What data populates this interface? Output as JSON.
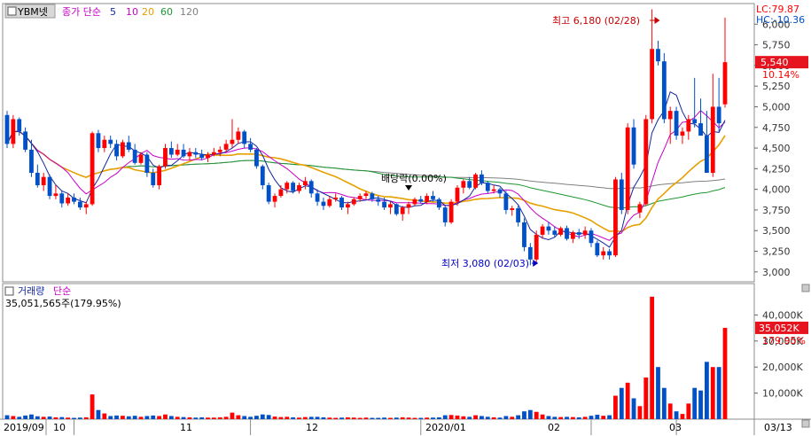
{
  "header": {
    "symbol": "YBM넷",
    "ma_label_prefix": "종가 단순",
    "ma_periods": [
      "5",
      "10",
      "20",
      "60",
      "120"
    ]
  },
  "right_badges": {
    "lc": "LC:79.87",
    "hc": "HC:-10.36"
  },
  "colors": {
    "up": "#ff0000",
    "down": "#0050c8",
    "ma5": "#1428a0",
    "ma10": "#c800c8",
    "ma20": "#e6a000",
    "ma60": "#1e9632",
    "ma120": "#808080",
    "current_price_bg": "#e6141e"
  },
  "annotations": {
    "high": "최고 6,180 (02/28)",
    "low": "최저 3,080 (02/03)",
    "dividend": "배당락(0.00%)"
  },
  "current": {
    "price": "5,540",
    "change": "10.14%",
    "volume": "35,052K",
    "volume_change": "179.95%"
  },
  "volume_panel": {
    "title": "거래량",
    "subtitle": "단순",
    "value_text": "35,051,565주(179.95%)"
  },
  "x_axis_labels": [
    "2019/09",
    "10",
    "11",
    "12",
    "2020/01",
    "02",
    "03",
    "03/13"
  ],
  "chart_data": {
    "type": "candlestick",
    "price_axis": {
      "ylim": [
        2880,
        6250
      ],
      "ticks": [
        3000,
        3250,
        3500,
        3750,
        4000,
        4250,
        4500,
        4750,
        5000,
        5250,
        5500,
        5750,
        6000
      ],
      "tick_labels": [
        "3,000",
        "3,250",
        "3,500",
        "3,750",
        "4,000",
        "4,250",
        "4,500",
        "4,750",
        "5,000",
        "5,250",
        "5,500",
        "5,750",
        "6,000"
      ]
    },
    "volume_axis": {
      "ylim": [
        0,
        50000
      ],
      "ticks": [
        10000,
        20000,
        30000,
        40000
      ],
      "tick_labels": [
        "10,000K",
        "20,000K",
        "30,000K",
        "40,000K"
      ]
    },
    "candles": [
      [
        4900,
        4950,
        4500,
        4550,
        1500
      ],
      [
        4550,
        4900,
        4500,
        4850,
        1200
      ],
      [
        4850,
        4870,
        4650,
        4700,
        900
      ],
      [
        4700,
        4750,
        4450,
        4480,
        1400
      ],
      [
        4480,
        4600,
        4150,
        4200,
        1800
      ],
      [
        4200,
        4300,
        4020,
        4050,
        1100
      ],
      [
        4050,
        4200,
        3980,
        4150,
        900
      ],
      [
        4150,
        4180,
        3880,
        3920,
        1000
      ],
      [
        3920,
        4050,
        3880,
        3950,
        700
      ],
      [
        3950,
        3980,
        3780,
        3830,
        800
      ],
      [
        3830,
        3950,
        3800,
        3900,
        600
      ],
      [
        3900,
        3950,
        3820,
        3850,
        500
      ],
      [
        3850,
        3900,
        3750,
        3780,
        600
      ],
      [
        3780,
        3850,
        3700,
        3820,
        700
      ],
      [
        3820,
        4700,
        3800,
        4680,
        9500
      ],
      [
        4680,
        4720,
        4450,
        4500,
        3500
      ],
      [
        4500,
        4650,
        4450,
        4600,
        2200
      ],
      [
        4600,
        4650,
        4500,
        4550,
        1200
      ],
      [
        4550,
        4600,
        4350,
        4400,
        1400
      ],
      [
        4400,
        4600,
        4380,
        4570,
        1300
      ],
      [
        4570,
        4650,
        4450,
        4480,
        1100
      ],
      [
        4480,
        4550,
        4300,
        4320,
        1300
      ],
      [
        4320,
        4450,
        4300,
        4420,
        900
      ],
      [
        4420,
        4450,
        4150,
        4200,
        1200
      ],
      [
        4200,
        4250,
        4020,
        4050,
        1400
      ],
      [
        4050,
        4300,
        4000,
        4280,
        1200
      ],
      [
        4280,
        4550,
        4250,
        4500,
        1800
      ],
      [
        4500,
        4580,
        4380,
        4420,
        1200
      ],
      [
        4420,
        4550,
        4400,
        4480,
        900
      ],
      [
        4480,
        4550,
        4380,
        4400,
        800
      ],
      [
        4400,
        4500,
        4350,
        4450,
        700
      ],
      [
        4450,
        4500,
        4380,
        4420,
        600
      ],
      [
        4420,
        4480,
        4350,
        4380,
        700
      ],
      [
        4380,
        4450,
        4330,
        4420,
        600
      ],
      [
        4420,
        4500,
        4400,
        4450,
        600
      ],
      [
        4450,
        4520,
        4400,
        4480,
        700
      ],
      [
        4480,
        4600,
        4450,
        4550,
        900
      ],
      [
        4550,
        4850,
        4500,
        4600,
        2500
      ],
      [
        4600,
        4750,
        4550,
        4700,
        1500
      ],
      [
        4700,
        4720,
        4500,
        4550,
        1200
      ],
      [
        4550,
        4620,
        4450,
        4480,
        900
      ],
      [
        4480,
        4500,
        4250,
        4280,
        1300
      ],
      [
        4280,
        4300,
        4000,
        4050,
        1800
      ],
      [
        4050,
        4080,
        3820,
        3850,
        1600
      ],
      [
        3850,
        3950,
        3780,
        3920,
        1000
      ],
      [
        3920,
        4050,
        3900,
        4000,
        800
      ],
      [
        4000,
        4100,
        3950,
        4080,
        900
      ],
      [
        4080,
        4100,
        3950,
        3980,
        700
      ],
      [
        3980,
        4080,
        3950,
        4050,
        600
      ],
      [
        4050,
        4150,
        4000,
        4100,
        800
      ],
      [
        4100,
        4120,
        3900,
        3950,
        900
      ],
      [
        3950,
        4000,
        3800,
        3850,
        900
      ],
      [
        3850,
        3900,
        3750,
        3800,
        700
      ],
      [
        3800,
        3920,
        3780,
        3880,
        600
      ],
      [
        3880,
        3950,
        3850,
        3900,
        500
      ],
      [
        3900,
        3920,
        3750,
        3780,
        600
      ],
      [
        3780,
        3850,
        3700,
        3820,
        700
      ],
      [
        3820,
        3900,
        3800,
        3880,
        600
      ],
      [
        3880,
        3950,
        3850,
        3920,
        500
      ],
      [
        3920,
        3980,
        3880,
        3950,
        600
      ],
      [
        3950,
        3970,
        3850,
        3880,
        500
      ],
      [
        3880,
        3920,
        3800,
        3850,
        500
      ],
      [
        3850,
        3900,
        3750,
        3780,
        600
      ],
      [
        3780,
        3850,
        3700,
        3820,
        500
      ],
      [
        3820,
        3830,
        3680,
        3700,
        600
      ],
      [
        3700,
        3800,
        3620,
        3780,
        700
      ],
      [
        3780,
        3850,
        3700,
        3820,
        600
      ],
      [
        3820,
        3900,
        3800,
        3880,
        500
      ],
      [
        3880,
        3920,
        3830,
        3850,
        500
      ],
      [
        3850,
        3950,
        3820,
        3920,
        600
      ],
      [
        3920,
        3980,
        3850,
        3880,
        600
      ],
      [
        3880,
        3900,
        3750,
        3780,
        700
      ],
      [
        3780,
        3800,
        3550,
        3600,
        1500
      ],
      [
        3600,
        3880,
        3580,
        3850,
        1600
      ],
      [
        3850,
        4050,
        3800,
        4020,
        1400
      ],
      [
        4020,
        4120,
        3950,
        4100,
        1100
      ],
      [
        4100,
        4150,
        4000,
        4020,
        900
      ],
      [
        4020,
        4200,
        4000,
        4180,
        1500
      ],
      [
        4180,
        4230,
        4050,
        4080,
        1200
      ],
      [
        4080,
        4100,
        3950,
        3980,
        900
      ],
      [
        3980,
        4050,
        3950,
        4000,
        700
      ],
      [
        4000,
        4020,
        3900,
        3950,
        600
      ],
      [
        3950,
        3980,
        3700,
        3750,
        1200
      ],
      [
        3750,
        3800,
        3680,
        3770,
        900
      ],
      [
        3770,
        3800,
        3550,
        3600,
        1500
      ],
      [
        3600,
        3650,
        3250,
        3300,
        3000
      ],
      [
        3300,
        3350,
        3080,
        3150,
        3500
      ],
      [
        3150,
        3500,
        3100,
        3450,
        2800
      ],
      [
        3450,
        3580,
        3400,
        3550,
        1800
      ],
      [
        3550,
        3600,
        3450,
        3500,
        1200
      ],
      [
        3500,
        3550,
        3420,
        3450,
        900
      ],
      [
        3450,
        3550,
        3430,
        3530,
        800
      ],
      [
        3530,
        3560,
        3380,
        3400,
        900
      ],
      [
        3400,
        3500,
        3350,
        3480,
        800
      ],
      [
        3480,
        3520,
        3400,
        3450,
        700
      ],
      [
        3450,
        3550,
        3400,
        3500,
        900
      ],
      [
        3500,
        3530,
        3300,
        3350,
        1300
      ],
      [
        3350,
        3380,
        3180,
        3200,
        1700
      ],
      [
        3200,
        3300,
        3150,
        3250,
        1300
      ],
      [
        3250,
        3280,
        3150,
        3200,
        1500
      ],
      [
        3200,
        4150,
        3180,
        4120,
        9000
      ],
      [
        4120,
        4200,
        3700,
        3750,
        12000
      ],
      [
        3750,
        4800,
        3700,
        4750,
        14000
      ],
      [
        4750,
        4850,
        4250,
        4300,
        8000
      ],
      [
        3720,
        3850,
        3650,
        3820,
        5000
      ],
      [
        3820,
        4900,
        3800,
        4850,
        16000
      ],
      [
        4850,
        6180,
        4800,
        5700,
        47000
      ],
      [
        5700,
        5800,
        5500,
        5550,
        20000
      ],
      [
        5550,
        5650,
        4800,
        4850,
        12000
      ],
      [
        4850,
        5000,
        4550,
        4950,
        6000
      ],
      [
        4950,
        5000,
        4600,
        4650,
        3000
      ],
      [
        4650,
        4750,
        4550,
        4700,
        2000
      ],
      [
        4700,
        4900,
        4600,
        4850,
        6000
      ],
      [
        4850,
        5350,
        4750,
        4800,
        12000
      ],
      [
        4800,
        5100,
        4700,
        4650,
        11000
      ],
      [
        4650,
        4950,
        4200,
        4200,
        22000
      ],
      [
        4200,
        5400,
        4150,
        5000,
        20000
      ],
      [
        5000,
        5350,
        4700,
        4800,
        20000
      ],
      [
        5030,
        6080,
        4990,
        5540,
        35052
      ]
    ]
  }
}
